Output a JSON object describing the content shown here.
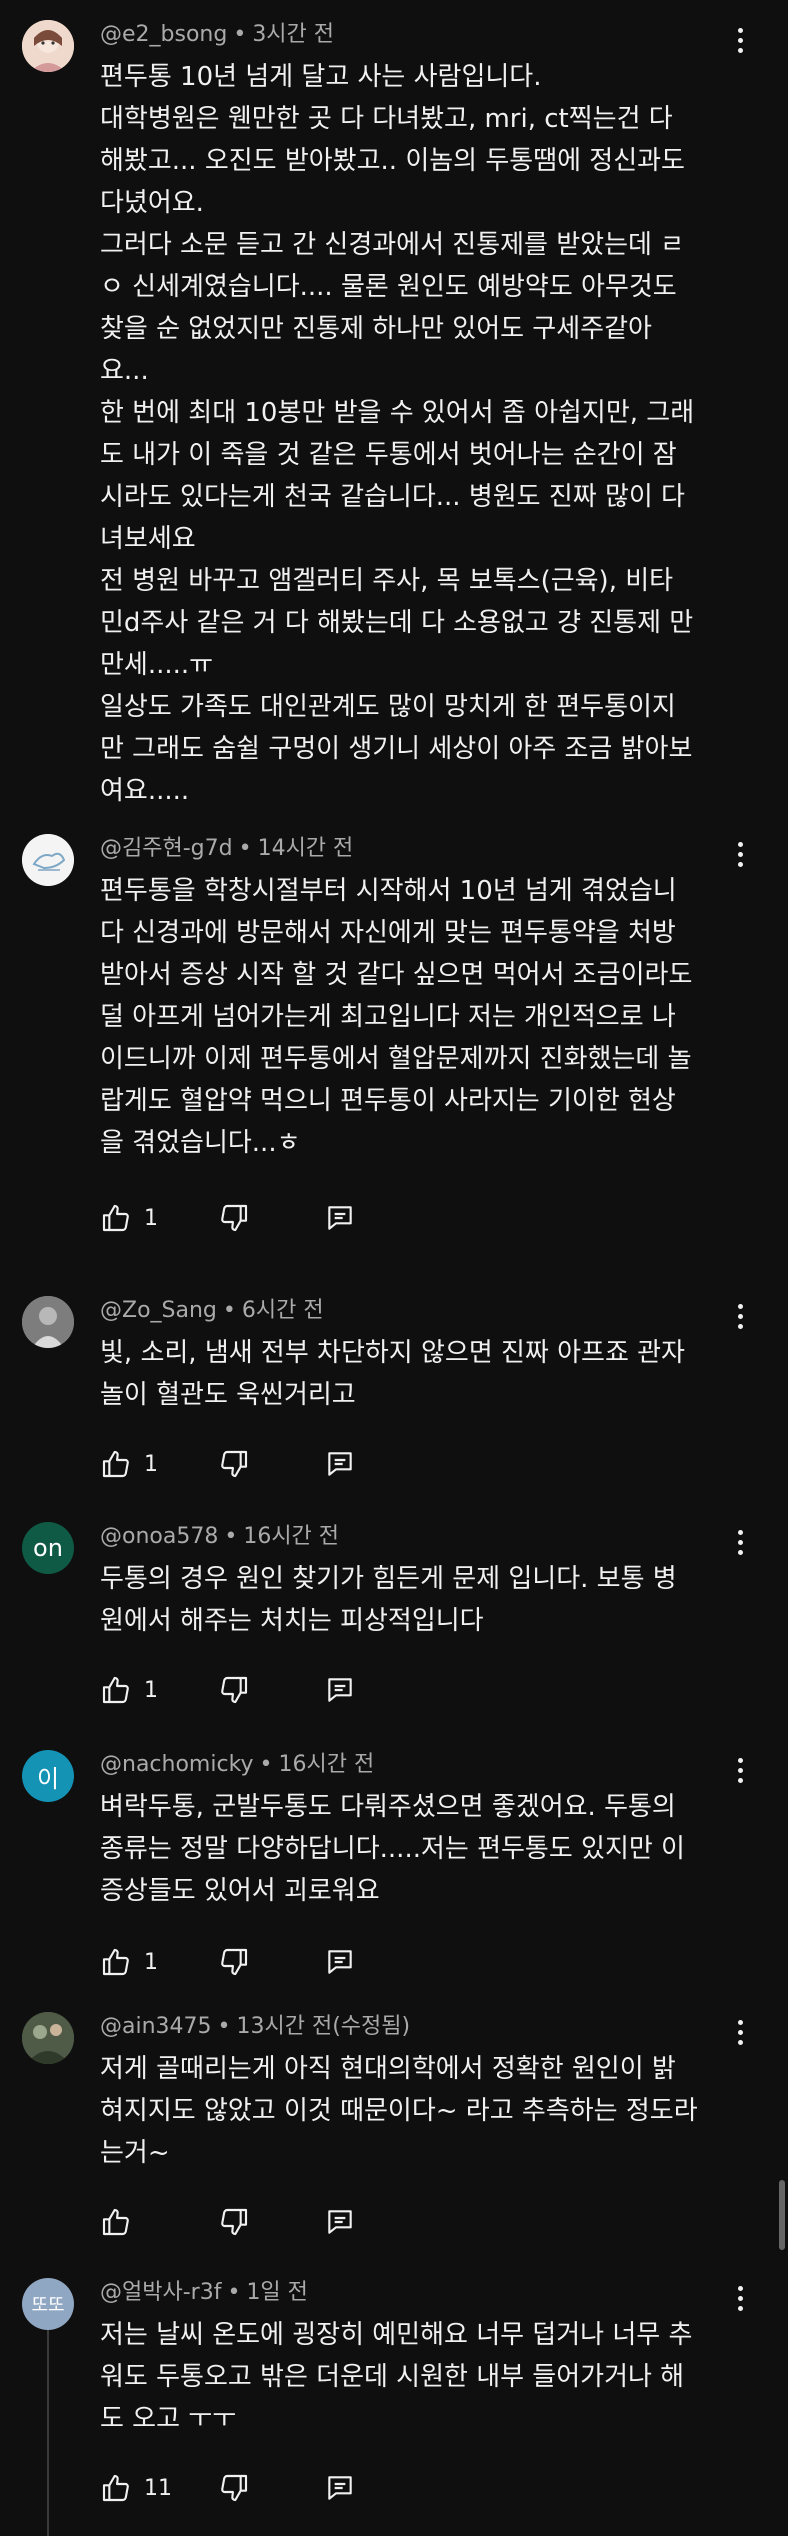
{
  "comments": [
    {
      "avatar_text": "",
      "avatar_color": "#e8c9b8",
      "username": "@e2_bsong",
      "time": "3시간 전",
      "body": "편두통 10년 넘게 달고 사는 사람입니다.\n대학병원은 웬만한 곳 다 다녀봤고, mri, ct찍는건 다\n해봤고... 오진도 받아봤고.. 이놈의 두통땜에 정신과도\n다녔어요.\n그러다 소문 듣고 간 신경과에서 진통제를 받았는데 ㄹ\nㅇ 신세계였습니다.... 물론 원인도 예방약도 아무것도\n찾을 순 없었지만 진통제 하나만 있어도 구세주같아\n요...\n한 번에 최대 10봉만 받을 수 있어서 좀 아쉽지만, 그래\n도 내가 이 죽을 것 같은 두통에서 벗어나는 순간이 잠\n시라도 있다는게 천국 같습니다... 병원도 진짜 많이 다\n녀보세요\n전 병원 바꾸고 앰겔러티 주사, 목 보톡스(근육), 비타\n민d주사 같은 거 다 해봤는데 다 소용없고 걍 진통제 만\n만세.....ㅠ\n일상도 가족도 대인관계도 많이 망치게 한 편두통이지\n만 그래도 숨쉴 구멍이 생기니 세상이 아주 조금 밝아보\n여요.....",
      "likes": ""
    },
    {
      "avatar_text": "",
      "avatar_color": "#f2f2f2",
      "username": "@김주현-g7d",
      "time": "14시간 전",
      "body": "편두통을 학창시절부터 시작해서 10년 넘게 겪었습니\n다 신경과에 방문해서 자신에게 맞는 편두통약을 처방\n받아서 증상 시작 할 것 같다 싶으면 먹어서 조금이라도\n덜 아프게 넘어가는게 최고입니다 저는 개인적으로 나\n이드니까 이제 편두통에서 혈압문제까지 진화했는데 놀\n랍게도 혈압약 먹으니 편두통이 사라지는 기이한 현상\n을 겪었습니다...ㅎ",
      "likes": "1"
    },
    {
      "avatar_text": "",
      "avatar_color": "#8a8a8a",
      "username": "@Zo_Sang",
      "time": "6시간 전",
      "body": "빛, 소리, 냄새 전부 차단하지 않으면 진짜 아프죠 관자\n놀이 혈관도 욱씬거리고",
      "likes": "1"
    },
    {
      "avatar_text": "on",
      "avatar_color": "#0f5a44",
      "username": "@onoa578",
      "time": "16시간 전",
      "body": "두통의 경우 원인 찾기가 힘든게 문제 입니다. 보통 병\n원에서 해주는 처치는 피상적입니다",
      "likes": "1"
    },
    {
      "avatar_text": "이",
      "avatar_color": "#1493b5",
      "username": "@nachomicky",
      "time": "16시간 전",
      "body": "벼락두통, 군발두통도 다뤄주셨으면 좋겠어요. 두통의\n종류는 정말 다양하답니다.....저는 편두통도 있지만 이\n증상들도 있어서 괴로워요",
      "likes": "1"
    },
    {
      "avatar_text": "",
      "avatar_color": "#5b6a52",
      "username": "@ain3475",
      "time": "13시간 전(수정됨)",
      "body": "저게 골때리는게 아직 현대의학에서 정확한 원인이 밝\n혀지지도 않았고 이것 때문이다~ 라고 추측하는 정도라\n는거~",
      "likes": ""
    },
    {
      "avatar_text": "또또",
      "avatar_color": "#8fa7c2",
      "username": "@얼박사-r3f",
      "time": "1일 전",
      "body": "저는 날씨 온도에 굉장히 예민해요 너무 덥거나 너무 추\n워도 두통오고 밖은 더운데 시원한 내부 들어가거나 해\n도 오고 ㅜㅜ",
      "likes": "11"
    }
  ],
  "dot_separator": "•"
}
